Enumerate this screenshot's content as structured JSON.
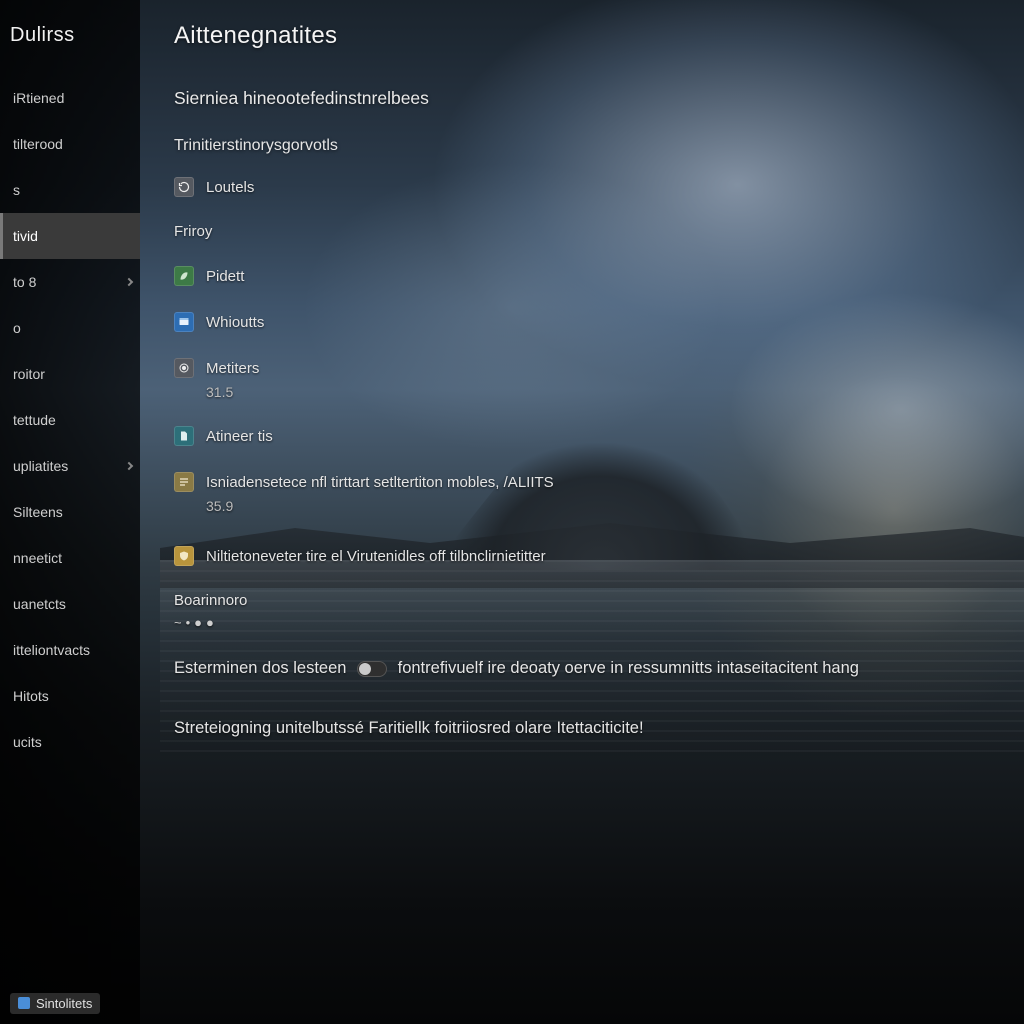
{
  "sidebar": {
    "title": "Dulirss",
    "items": [
      {
        "label": "iRtiened"
      },
      {
        "label": "tilterood"
      },
      {
        "label": "s"
      },
      {
        "label": "tivid",
        "selected": true
      },
      {
        "label": "to 8",
        "has_chevron": true
      },
      {
        "label": "o"
      },
      {
        "label": "roitor"
      },
      {
        "label": "tettude"
      },
      {
        "label": "upliatites",
        "has_chevron": true
      },
      {
        "label": "Silteens"
      },
      {
        "label": "nneetict"
      },
      {
        "label": "uanetcts"
      },
      {
        "label": "itteliontvacts"
      },
      {
        "label": "Hitots"
      },
      {
        "label": "ucits"
      }
    ],
    "bottom_chip": "Sintolitets"
  },
  "page": {
    "title": "Aittenegnatites",
    "section_head": "Sierniea hineootefedinstnrelbees",
    "sub_head": "Trinitierstinorysgorvotls",
    "row_refresh": "Loutels",
    "row_frinoy": "Friroy",
    "row_piedt": "Pidett",
    "row_windows": "Whioutts",
    "row_merters": "Metiters",
    "value_31s": "31.5",
    "row_amerts": "Atineer tis",
    "row_long_modes": "Isniadensetece nfl tirttart setltertiton mobles, /ALIITS",
    "value_359": "35.9",
    "row_milieter": "Niltietoneveter tire el Virutenidles off tilbnclirnietitter",
    "row_borrirard": "Boarinnoro",
    "spark_dots": "~•●●",
    "body_line_1_a": "Esterminen dos lesteen",
    "body_line_1_b": "fontrefivuelf ire deoaty oerve in ressumnitts intaseitacitent hang",
    "bottom_line": "Streteiogning unitelbutssé Faritiellk foitriiosred olare Itettaciticite!"
  }
}
